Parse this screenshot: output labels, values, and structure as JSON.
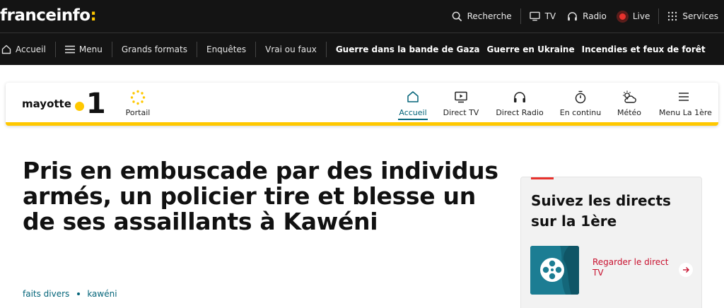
{
  "header": {
    "logo_text": "franceinfo",
    "logo_colon": ":",
    "actions": {
      "search": "Recherche",
      "tv": "TV",
      "radio": "Radio",
      "live": "Live",
      "services": "Services"
    }
  },
  "nav": {
    "home": "Accueil",
    "menu": "Menu",
    "items": [
      "Grands formats",
      "Enquêtes",
      "Vrai ou faux"
    ],
    "topics": [
      "Guerre dans la bande de Gaza",
      "Guerre en Ukraine",
      "Incendies et feux de forêt"
    ]
  },
  "regional": {
    "brand_name": "mayotte",
    "brand_number": "1",
    "portail": "Portail",
    "nav": [
      {
        "label": "Accueil",
        "icon": "home-icon",
        "active": true
      },
      {
        "label": "Direct TV",
        "icon": "tv-play-icon",
        "active": false
      },
      {
        "label": "Direct Radio",
        "icon": "headphones-icon",
        "active": false
      },
      {
        "label": "En continu",
        "icon": "stopwatch-icon",
        "active": false
      },
      {
        "label": "Météo",
        "icon": "weather-icon",
        "active": false
      },
      {
        "label": "Menu La 1ère",
        "icon": "menu-icon",
        "active": false
      }
    ]
  },
  "article": {
    "headline": "Pris en embuscade par des individus armés, un policier tire et blesse un de ses assaillants à Kawéni",
    "tags": [
      "faits divers",
      "kawéni"
    ]
  },
  "sidebar": {
    "title": "Suivez les directs sur la 1ère",
    "watch_label": "Regarder le direct TV"
  },
  "colors": {
    "accent_yellow": "#ffc800",
    "accent_teal": "#036479",
    "live_red": "#e8322d",
    "link_red": "#c8102e"
  }
}
